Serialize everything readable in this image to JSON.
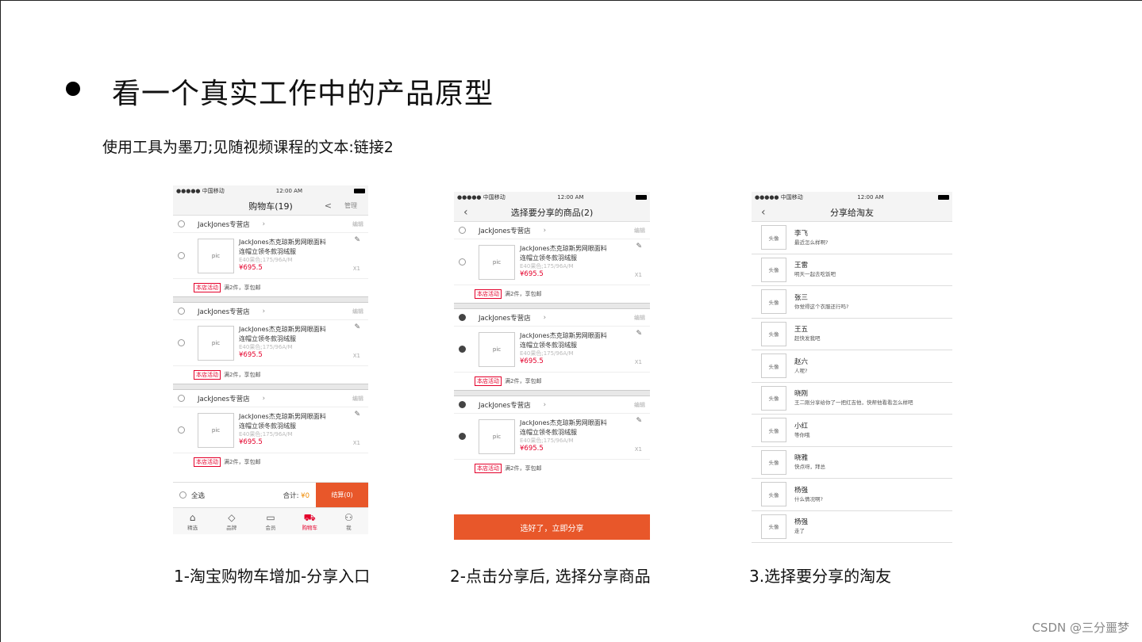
{
  "slide": {
    "title": "看一个真实工作中的产品原型",
    "subtitle": "使用工具为墨刀;见随视频课程的文本:链接2",
    "watermark": "CSDN @三分噩梦"
  },
  "captions": [
    "1-淘宝购物车增加-分享入口",
    "2-点击分享后, 选择分享商品",
    "3.选择要分享的淘友"
  ],
  "status": {
    "carrier": "●●●●● 中国移动",
    "time": "12:00 AM"
  },
  "common": {
    "store_name": "JackJones专营店",
    "edit": "编辑",
    "product_title_1": "JackJones杰克琼斯男网眼面料",
    "product_title_2": "连帽立领冬款羽绒服",
    "product_spec": "E40果色;175/96A/M",
    "price": "¥695.5",
    "qty": "X1",
    "pic": "pic",
    "promo_tag": "本店活动",
    "promo_text": "满2件，享包邮",
    "avatar": "头像"
  },
  "cart": {
    "title": "购物车(19)",
    "manage": "管理",
    "select_all": "全选",
    "total_label": "合计:",
    "total_value": "¥0",
    "checkout": "结算(0)",
    "tabs": [
      {
        "label": "精选",
        "icon": "home-icon"
      },
      {
        "label": "品牌",
        "icon": "diamond-icon"
      },
      {
        "label": "会员",
        "icon": "card-icon"
      },
      {
        "label": "购物车",
        "icon": "cart-icon"
      },
      {
        "label": "我",
        "icon": "user-icon"
      }
    ]
  },
  "select_goods": {
    "title": "选择要分享的商品(2)",
    "share_button": "选好了，立即分享"
  },
  "share_friends": {
    "title": "分享给淘友",
    "friends": [
      {
        "name": "李飞",
        "msg": "最近怎么样啊?"
      },
      {
        "name": "王雷",
        "msg": "明天一起去吃饭吧"
      },
      {
        "name": "张三",
        "msg": "你觉得这个衣服还行吗?"
      },
      {
        "name": "王五",
        "msg": "赶快发我吧"
      },
      {
        "name": "赵六",
        "msg": "人呢?"
      },
      {
        "name": "晓刚",
        "msg": "王二刚分享给你了一把红吉他，快帮他看看怎么样吧"
      },
      {
        "name": "小红",
        "msg": "等你哦"
      },
      {
        "name": "晓雅",
        "msg": "快点呀，拜总"
      },
      {
        "name": "杨强",
        "msg": "什么情况啊?"
      },
      {
        "name": "杨强",
        "msg": "走了"
      }
    ]
  }
}
